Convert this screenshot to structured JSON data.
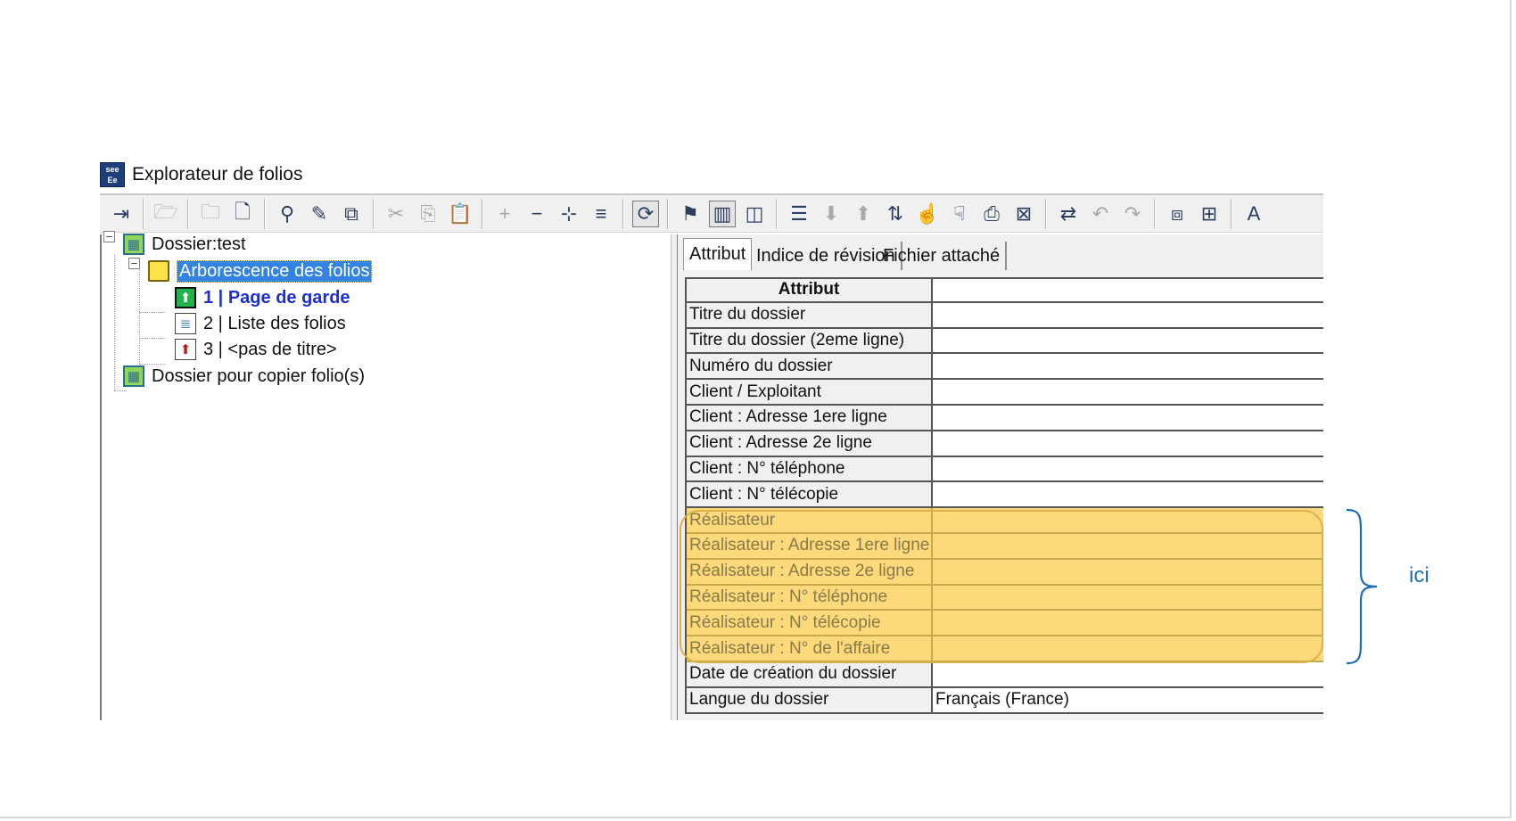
{
  "window": {
    "title": "Explorateur de folios",
    "app_icon_text_top": "see",
    "app_icon_text_bottom": "Ee"
  },
  "toolbar": {
    "buttons": [
      {
        "name": "exit-icon",
        "glyph": "⇥",
        "enabled": true
      },
      {
        "sep": true
      },
      {
        "name": "open-folder-icon",
        "glyph": "🗁",
        "enabled": false
      },
      {
        "sep": true
      },
      {
        "name": "folder-icon",
        "glyph": "🗀",
        "enabled": false
      },
      {
        "name": "new-page-icon",
        "glyph": "🗋",
        "enabled": true
      },
      {
        "sep": true
      },
      {
        "name": "search-properties-icon",
        "glyph": "⚲",
        "enabled": true
      },
      {
        "name": "edit-list-icon",
        "glyph": "✎",
        "enabled": true
      },
      {
        "name": "copy-pages-icon",
        "glyph": "⧉",
        "enabled": true
      },
      {
        "sep": true
      },
      {
        "name": "cut-icon",
        "glyph": "✂",
        "enabled": false
      },
      {
        "name": "copy-icon",
        "glyph": "⎘",
        "enabled": false
      },
      {
        "name": "paste-icon",
        "glyph": "📋",
        "enabled": false
      },
      {
        "sep": true
      },
      {
        "name": "plus-icon",
        "glyph": "+",
        "enabled": false
      },
      {
        "name": "minus-icon",
        "glyph": "−",
        "enabled": true
      },
      {
        "name": "insert-level-icon",
        "glyph": "⊹",
        "enabled": true
      },
      {
        "name": "align-icon",
        "glyph": "≡",
        "enabled": true
      },
      {
        "sep": true
      },
      {
        "name": "refresh-icon",
        "glyph": "⟳",
        "enabled": true,
        "pressed": true
      },
      {
        "sep": true
      },
      {
        "name": "flag-icon",
        "glyph": "⚑",
        "enabled": true
      },
      {
        "name": "columns-view-icon",
        "glyph": "▥",
        "enabled": true,
        "pressed": true
      },
      {
        "name": "split-view-icon",
        "glyph": "◫",
        "enabled": true
      },
      {
        "sep": true
      },
      {
        "name": "list-indent-icon",
        "glyph": "☰",
        "enabled": true
      },
      {
        "name": "move-down-icon",
        "glyph": "⬇",
        "enabled": false
      },
      {
        "name": "move-up-icon",
        "glyph": "⬆",
        "enabled": false
      },
      {
        "name": "sort-icon",
        "glyph": "⇅",
        "enabled": true
      },
      {
        "name": "hand-up-icon",
        "glyph": "☝",
        "enabled": true
      },
      {
        "name": "hand-down-icon",
        "glyph": "☟",
        "enabled": true
      },
      {
        "name": "export-icon",
        "glyph": "⎙",
        "enabled": true
      },
      {
        "name": "delete-list-icon",
        "glyph": "⊠",
        "enabled": true
      },
      {
        "sep": true
      },
      {
        "name": "sync-icon",
        "glyph": "⇄",
        "enabled": true
      },
      {
        "name": "undo-icon",
        "glyph": "↶",
        "enabled": false
      },
      {
        "name": "redo-icon",
        "glyph": "↷",
        "enabled": false
      },
      {
        "sep": true
      },
      {
        "name": "document-copy-icon",
        "glyph": "⧈",
        "enabled": true
      },
      {
        "name": "document-settings-icon",
        "glyph": "⊞",
        "enabled": true
      },
      {
        "sep": true
      },
      {
        "name": "font-icon",
        "glyph": "A",
        "enabled": true
      }
    ]
  },
  "tree": {
    "root": "Dossier:test",
    "folder": "Arborescence des folios",
    "pages": [
      {
        "label": "1 | Page de garde"
      },
      {
        "label": "2 | Liste des folios"
      },
      {
        "label": "3 | <pas de titre>"
      }
    ],
    "copy_folder": "Dossier pour copier folio(s)"
  },
  "tabs": [
    "Attribut",
    "Indice de révision",
    "Fichier attaché"
  ],
  "grid": {
    "header": "Attribut",
    "rows": [
      {
        "attr": "Titre du dossier",
        "value": "",
        "hl": false
      },
      {
        "attr": "Titre du dossier (2eme ligne)",
        "value": "",
        "hl": false
      },
      {
        "attr": "Numéro du dossier",
        "value": "",
        "hl": false
      },
      {
        "attr": "Client / Exploitant",
        "value": "",
        "hl": false
      },
      {
        "attr": "Client : Adresse 1ere ligne",
        "value": "",
        "hl": false
      },
      {
        "attr": "Client : Adresse 2e ligne",
        "value": "",
        "hl": false
      },
      {
        "attr": "Client : N° téléphone",
        "value": "",
        "hl": false
      },
      {
        "attr": "Client : N° télécopie",
        "value": "",
        "hl": false
      },
      {
        "attr": "Réalisateur",
        "value": "",
        "hl": true
      },
      {
        "attr": "Réalisateur : Adresse 1ere ligne",
        "value": "",
        "hl": true
      },
      {
        "attr": "Réalisateur : Adresse 2e ligne",
        "value": "",
        "hl": true
      },
      {
        "attr": "Réalisateur : N° téléphone",
        "value": "",
        "hl": true
      },
      {
        "attr": "Réalisateur : N° télécopie",
        "value": "",
        "hl": true
      },
      {
        "attr": "Réalisateur : N° de l'affaire",
        "value": "",
        "hl": true
      },
      {
        "attr": "Date de création du dossier",
        "value": "",
        "hl": false
      },
      {
        "attr": "Langue du dossier",
        "value": "Français (France)",
        "hl": false
      }
    ]
  },
  "annotation": {
    "label": "ici",
    "color": "#1c6fb3",
    "highlight_color": "#fcd97a"
  }
}
